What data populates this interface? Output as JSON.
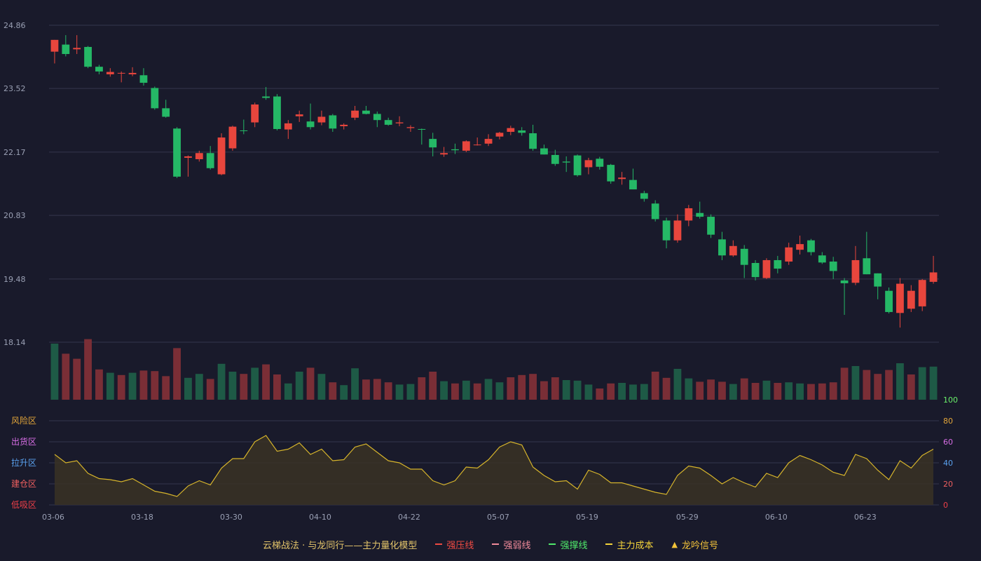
{
  "colors": {
    "up": "#e8463d",
    "down": "#25b866",
    "vol_up": "#7a2e36",
    "vol_down": "#1e5a46",
    "grid": "#34364d",
    "osc_line": "#d6b42b",
    "osc_fill": "#3a3325"
  },
  "chart_data": [
    {
      "type": "candlestick",
      "ylim": [
        18.14,
        24.86
      ],
      "yticks": [
        "24.86",
        "23.52",
        "22.17",
        "20.83",
        "19.48",
        "18.14"
      ],
      "xticks": [
        {
          "i": 0,
          "label": "03-06"
        },
        {
          "i": 8,
          "label": "03-18"
        },
        {
          "i": 16,
          "label": "03-30"
        },
        {
          "i": 24,
          "label": "04-10"
        },
        {
          "i": 32,
          "label": "04-22"
        },
        {
          "i": 40,
          "label": "05-07"
        },
        {
          "i": 48,
          "label": "05-19"
        },
        {
          "i": 57,
          "label": "05-29"
        },
        {
          "i": 65,
          "label": "06-10"
        },
        {
          "i": 73,
          "label": "06-23"
        }
      ],
      "ohlc": [
        [
          24.3,
          24.55,
          24.05,
          24.55
        ],
        [
          24.45,
          24.65,
          24.2,
          24.25
        ],
        [
          24.35,
          24.65,
          24.25,
          24.38
        ],
        [
          24.4,
          24.42,
          23.95,
          23.98
        ],
        [
          23.98,
          24.02,
          23.82,
          23.88
        ],
        [
          23.82,
          23.95,
          23.77,
          23.87
        ],
        [
          23.85,
          23.88,
          23.65,
          23.85
        ],
        [
          23.82,
          23.97,
          23.78,
          23.85
        ],
        [
          23.8,
          23.95,
          23.58,
          23.64
        ],
        [
          23.53,
          23.56,
          23.07,
          23.1
        ],
        [
          23.1,
          23.28,
          22.9,
          22.92
        ],
        [
          22.67,
          22.7,
          21.62,
          21.65
        ],
        [
          22.05,
          22.1,
          21.65,
          22.08
        ],
        [
          22.02,
          22.2,
          21.97,
          22.15
        ],
        [
          22.15,
          22.3,
          21.8,
          21.83
        ],
        [
          21.7,
          22.57,
          21.68,
          22.48
        ],
        [
          22.25,
          22.73,
          22.2,
          22.71
        ],
        [
          22.63,
          22.86,
          22.55,
          22.62
        ],
        [
          22.8,
          23.22,
          22.7,
          23.18
        ],
        [
          23.35,
          23.55,
          23.28,
          23.32
        ],
        [
          23.35,
          23.4,
          22.63,
          22.66
        ],
        [
          22.65,
          22.85,
          22.45,
          22.78
        ],
        [
          22.93,
          23.05,
          22.81,
          22.97
        ],
        [
          22.82,
          23.2,
          22.65,
          22.7
        ],
        [
          22.8,
          23.05,
          22.74,
          22.92
        ],
        [
          22.95,
          22.98,
          22.6,
          22.67
        ],
        [
          22.72,
          22.78,
          22.65,
          22.75
        ],
        [
          22.9,
          23.15,
          22.85,
          23.05
        ],
        [
          23.05,
          23.15,
          22.97,
          22.98
        ],
        [
          22.98,
          23.03,
          22.7,
          22.85
        ],
        [
          22.85,
          22.9,
          22.73,
          22.75
        ],
        [
          22.78,
          22.93,
          22.72,
          22.8
        ],
        [
          22.68,
          22.74,
          22.6,
          22.7
        ],
        [
          22.66,
          22.67,
          22.33,
          22.65
        ],
        [
          22.45,
          22.58,
          22.08,
          22.27
        ],
        [
          22.12,
          22.28,
          22.07,
          22.15
        ],
        [
          22.23,
          22.35,
          22.13,
          22.21
        ],
        [
          22.2,
          22.42,
          22.17,
          22.4
        ],
        [
          22.32,
          22.48,
          22.31,
          22.33
        ],
        [
          22.35,
          22.55,
          22.3,
          22.45
        ],
        [
          22.5,
          22.6,
          22.44,
          22.58
        ],
        [
          22.6,
          22.73,
          22.53,
          22.68
        ],
        [
          22.63,
          22.7,
          22.52,
          22.58
        ],
        [
          22.57,
          22.75,
          22.2,
          22.24
        ],
        [
          22.25,
          22.33,
          22.12,
          22.12
        ],
        [
          22.11,
          22.22,
          21.88,
          21.92
        ],
        [
          21.97,
          22.08,
          21.75,
          21.95
        ],
        [
          22.1,
          22.12,
          21.65,
          21.68
        ],
        [
          21.85,
          22.05,
          21.7,
          22.0
        ],
        [
          22.03,
          22.07,
          21.8,
          21.86
        ],
        [
          21.9,
          21.92,
          21.5,
          21.55
        ],
        [
          21.6,
          21.75,
          21.48,
          21.63
        ],
        [
          21.58,
          21.82,
          21.38,
          21.38
        ],
        [
          21.3,
          21.35,
          21.12,
          21.18
        ],
        [
          21.08,
          21.15,
          20.7,
          20.75
        ],
        [
          20.72,
          20.78,
          20.13,
          20.3
        ],
        [
          20.3,
          20.85,
          20.25,
          20.72
        ],
        [
          20.72,
          21.05,
          20.6,
          20.98
        ],
        [
          20.88,
          21.12,
          20.76,
          20.8
        ],
        [
          20.8,
          20.85,
          20.35,
          20.42
        ],
        [
          20.32,
          20.48,
          19.88,
          19.98
        ],
        [
          19.98,
          20.3,
          19.95,
          20.18
        ],
        [
          20.12,
          20.2,
          19.5,
          19.78
        ],
        [
          19.82,
          19.88,
          19.45,
          19.52
        ],
        [
          19.5,
          19.92,
          19.48,
          19.88
        ],
        [
          19.88,
          19.97,
          19.6,
          19.7
        ],
        [
          19.85,
          20.25,
          19.78,
          20.15
        ],
        [
          20.1,
          20.4,
          20.0,
          20.22
        ],
        [
          20.3,
          20.33,
          19.98,
          20.05
        ],
        [
          19.98,
          20.05,
          19.8,
          19.83
        ],
        [
          19.85,
          19.95,
          19.48,
          19.65
        ],
        [
          19.45,
          19.5,
          18.72,
          19.39
        ],
        [
          19.4,
          20.18,
          19.35,
          19.88
        ],
        [
          19.92,
          20.48,
          19.58,
          19.58
        ],
        [
          19.6,
          19.6,
          19.05,
          19.32
        ],
        [
          19.23,
          19.3,
          18.75,
          18.78
        ],
        [
          18.76,
          19.5,
          18.45,
          19.38
        ],
        [
          18.85,
          19.35,
          18.78,
          19.23
        ],
        [
          18.9,
          19.48,
          18.8,
          19.46
        ],
        [
          19.42,
          19.97,
          19.38,
          19.62
        ]
      ],
      "volume": [
        [
          1.0,
          0
        ],
        [
          0.82,
          1
        ],
        [
          0.73,
          1
        ],
        [
          1.08,
          1
        ],
        [
          0.54,
          1
        ],
        [
          0.48,
          0
        ],
        [
          0.44,
          1
        ],
        [
          0.48,
          0
        ],
        [
          0.52,
          1
        ],
        [
          0.51,
          1
        ],
        [
          0.42,
          1
        ],
        [
          0.92,
          1
        ],
        [
          0.39,
          0
        ],
        [
          0.46,
          0
        ],
        [
          0.37,
          1
        ],
        [
          0.64,
          0
        ],
        [
          0.5,
          0
        ],
        [
          0.46,
          1
        ],
        [
          0.57,
          0
        ],
        [
          0.63,
          1
        ],
        [
          0.45,
          1
        ],
        [
          0.29,
          0
        ],
        [
          0.5,
          0
        ],
        [
          0.57,
          1
        ],
        [
          0.46,
          0
        ],
        [
          0.31,
          1
        ],
        [
          0.26,
          0
        ],
        [
          0.56,
          0
        ],
        [
          0.36,
          1
        ],
        [
          0.37,
          1
        ],
        [
          0.31,
          1
        ],
        [
          0.27,
          0
        ],
        [
          0.28,
          0
        ],
        [
          0.4,
          1
        ],
        [
          0.5,
          1
        ],
        [
          0.33,
          0
        ],
        [
          0.29,
          1
        ],
        [
          0.34,
          0
        ],
        [
          0.29,
          1
        ],
        [
          0.37,
          0
        ],
        [
          0.31,
          0
        ],
        [
          0.4,
          1
        ],
        [
          0.44,
          1
        ],
        [
          0.46,
          1
        ],
        [
          0.33,
          1
        ],
        [
          0.4,
          1
        ],
        [
          0.35,
          0
        ],
        [
          0.34,
          0
        ],
        [
          0.27,
          0
        ],
        [
          0.2,
          1
        ],
        [
          0.29,
          1
        ],
        [
          0.3,
          0
        ],
        [
          0.27,
          0
        ],
        [
          0.28,
          0
        ],
        [
          0.5,
          1
        ],
        [
          0.39,
          1
        ],
        [
          0.55,
          0
        ],
        [
          0.38,
          0
        ],
        [
          0.32,
          1
        ],
        [
          0.36,
          1
        ],
        [
          0.32,
          1
        ],
        [
          0.28,
          0
        ],
        [
          0.38,
          1
        ],
        [
          0.3,
          1
        ],
        [
          0.34,
          0
        ],
        [
          0.3,
          1
        ],
        [
          0.31,
          0
        ],
        [
          0.29,
          0
        ],
        [
          0.28,
          1
        ],
        [
          0.29,
          1
        ],
        [
          0.31,
          1
        ],
        [
          0.57,
          1
        ],
        [
          0.6,
          0
        ],
        [
          0.53,
          1
        ],
        [
          0.46,
          1
        ],
        [
          0.53,
          1
        ],
        [
          0.65,
          0
        ],
        [
          0.45,
          1
        ],
        [
          0.58,
          0
        ],
        [
          0.59,
          0
        ]
      ]
    },
    {
      "type": "area",
      "ylim": [
        0,
        100
      ],
      "yticks": [
        "100",
        "80",
        "60",
        "40",
        "20",
        "0"
      ],
      "zones": [
        {
          "label": "风险区",
          "level": 80,
          "color": "#e3a63a"
        },
        {
          "label": "出货区",
          "level": 60,
          "color": "#d86ee6"
        },
        {
          "label": "拉升区",
          "level": 40,
          "color": "#5aa2f0"
        },
        {
          "label": "建仓区",
          "level": 20,
          "color": "#ee5f5f"
        },
        {
          "label": "低吸区",
          "level": 0,
          "color": "#ee3f48"
        }
      ],
      "values": [
        48,
        40,
        42,
        30,
        25,
        24,
        22,
        25,
        19,
        13,
        11,
        8,
        18,
        23,
        19,
        35,
        44,
        44,
        60,
        66,
        51,
        53,
        59,
        48,
        53,
        42,
        43,
        55,
        58,
        50,
        42,
        40,
        34,
        34,
        23,
        19,
        23,
        36,
        35,
        43,
        55,
        60,
        57,
        36,
        28,
        22,
        23,
        15,
        33,
        29,
        21,
        21,
        18,
        15,
        12,
        10,
        28,
        37,
        35,
        28,
        20,
        26,
        21,
        17,
        30,
        26,
        40,
        47,
        43,
        38,
        31,
        28,
        48,
        44,
        33,
        24,
        42,
        35,
        47,
        53
      ]
    }
  ],
  "legend": {
    "title": "云梯战法 · 与龙同行——主力量化模型",
    "items": [
      {
        "label": "强压线",
        "color": "#ee4a42",
        "style": "solid"
      },
      {
        "label": "强弱线",
        "color": "#f08a9a",
        "style": "dash"
      },
      {
        "label": "强撑线",
        "color": "#4fe86a",
        "style": "solid"
      },
      {
        "label": "主力成本",
        "color": "#f3d33a",
        "style": "dash"
      },
      {
        "label": "龙吟信号",
        "color": "#f3c33a",
        "style": "triangle"
      }
    ]
  }
}
